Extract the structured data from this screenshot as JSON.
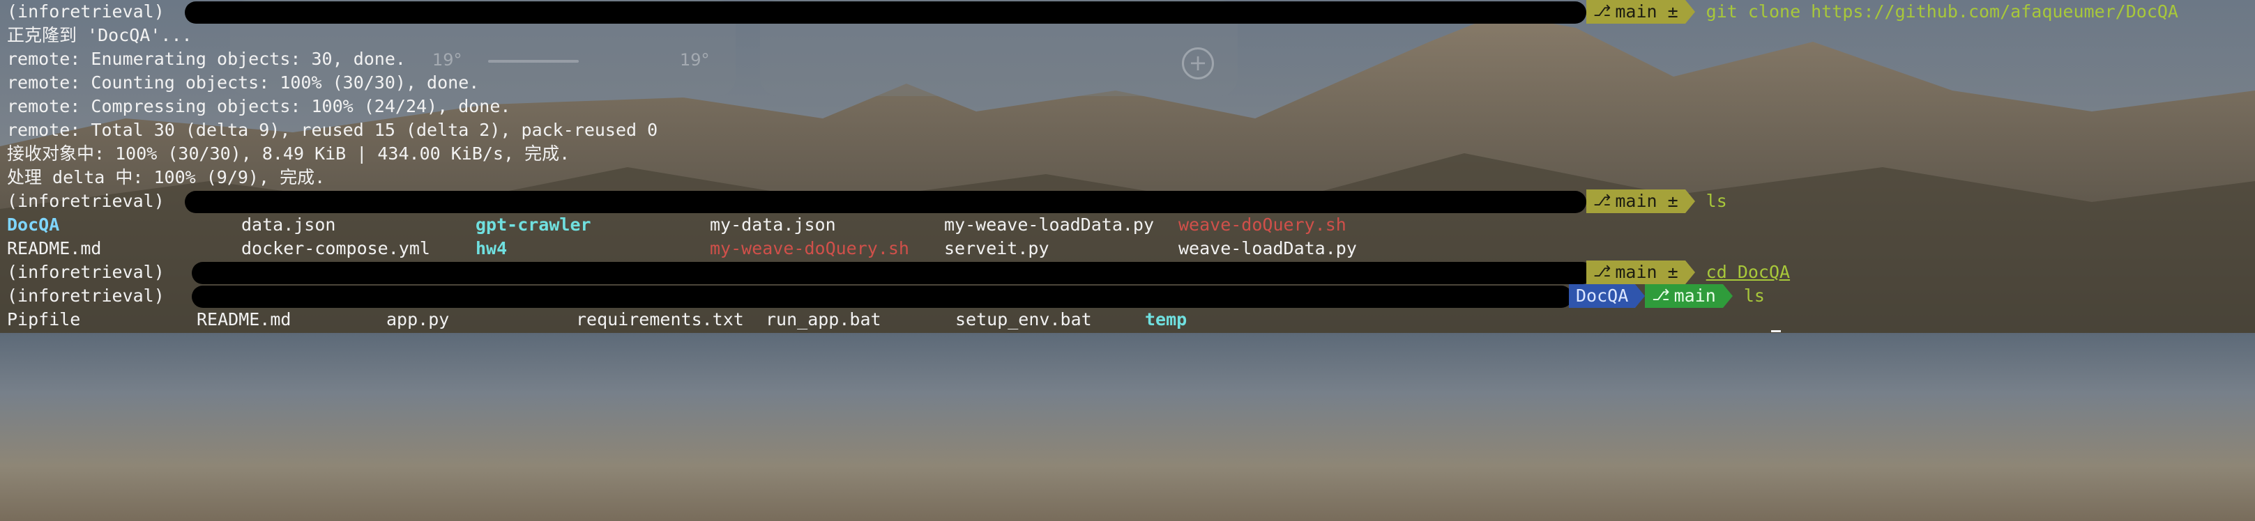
{
  "colors": {
    "directory": "#7fd6ff",
    "executable": "#d0504a",
    "branch_bg": "#a5a23a",
    "dir_segment_bg": "#2f55ad",
    "branch_green_bg": "#2f9c3b",
    "command": "#a8c83a"
  },
  "desktop": {
    "widget_left_value": "19°",
    "widget_left_value2": "19°",
    "widget_right_icon": "plus-icon"
  },
  "terminal": {
    "prompt1": {
      "env": "(inforetrieval)",
      "branch": "main ±",
      "command": "git clone https://github.com/afaqueumer/DocQA"
    },
    "clone_output": [
      "正克隆到 'DocQA'...",
      "remote: Enumerating objects: 30, done.",
      "remote: Counting objects: 100% (30/30), done.",
      "remote: Compressing objects: 100% (24/24), done.",
      "remote: Total 30 (delta 9), reused 15 (delta 2), pack-reused 0",
      "接收对象中: 100% (30/30), 8.49 KiB | 434.00 KiB/s, 完成.",
      "处理 delta 中: 100% (9/9), 完成."
    ],
    "prompt2": {
      "env": "(inforetrieval)",
      "branch": "main ±",
      "command": "ls"
    },
    "ls1_row1": [
      "DocQA",
      "data.json",
      "gpt-crawler",
      "my-data.json",
      "my-weave-loadData.py",
      "weave-doQuery.sh"
    ],
    "ls1_row2": [
      "README.md",
      "docker-compose.yml",
      "hw4",
      "my-weave-doQuery.sh",
      "serveit.py",
      "weave-loadData.py"
    ],
    "prompt3": {
      "env": "(inforetrieval)",
      "branch": "main ±",
      "command": "cd DocQA"
    },
    "prompt4": {
      "env": "(inforetrieval)",
      "dir": "DocQA",
      "branch": "main",
      "command": "ls"
    },
    "ls2_row": [
      "Pipfile",
      "README.md",
      "app.py",
      "requirements.txt",
      "run_app.bat",
      "setup_env.bat",
      "temp"
    ]
  }
}
